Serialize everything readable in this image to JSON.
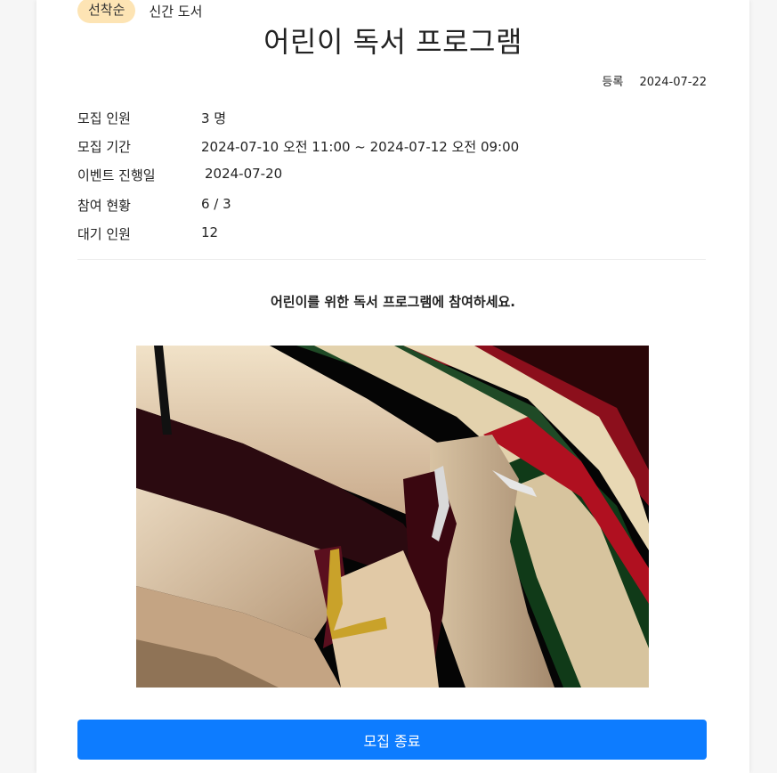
{
  "tags": {
    "badge": "선착순",
    "category": "신간 도서"
  },
  "title": "어린이 독서 프로그램",
  "registration": {
    "label": "등록",
    "date": "2024-07-22"
  },
  "info": [
    {
      "label": "모집 인원",
      "value": "3 명"
    },
    {
      "label": "모집 기간",
      "value": "2024-07-10 오전 11:00 ~ 2024-07-12 오전 09:00"
    },
    {
      "label": "이벤트 진행일",
      "value": "2024-07-20"
    },
    {
      "label": "참여 현황",
      "value": "6 / 3"
    },
    {
      "label": "대기 인원",
      "value": "12"
    }
  ],
  "description": "어린이를 위한 독서 프로그램에 참여하세요.",
  "image": {
    "subject": "stacked-books-photo"
  },
  "button": {
    "label": "모집 종료"
  },
  "colors": {
    "badge_bg": "#fde4b4",
    "button_bg": "#0d7cff",
    "page_bg": "#f6f6f6",
    "card_bg": "#ffffff"
  }
}
